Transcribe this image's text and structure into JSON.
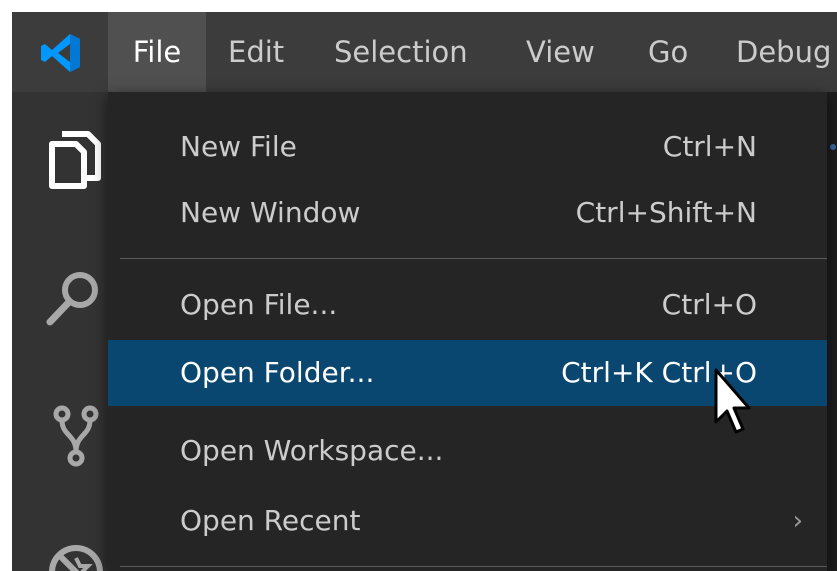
{
  "app": {
    "logo_icon": "vscode-logo-icon",
    "accent_color": "#0098ff"
  },
  "menubar": {
    "items": [
      {
        "label": "File",
        "active": true
      },
      {
        "label": "Edit"
      },
      {
        "label": "Selection"
      },
      {
        "label": "View"
      },
      {
        "label": "Go"
      },
      {
        "label": "Debug"
      }
    ]
  },
  "activitybar": {
    "icons": [
      "files-icon",
      "search-icon",
      "source-control-icon",
      "extensions-icon"
    ]
  },
  "file_menu": {
    "items": [
      {
        "label": "New File",
        "shortcut": "Ctrl+N"
      },
      {
        "label": "New Window",
        "shortcut": "Ctrl+Shift+N"
      },
      {
        "label": "Open File...",
        "shortcut": "Ctrl+O"
      },
      {
        "label": "Open Folder...",
        "shortcut": "Ctrl+K Ctrl+O",
        "selected": true
      },
      {
        "label": "Open Workspace..."
      },
      {
        "label": "Open Recent",
        "submenu_icon": "chevron-right-icon"
      }
    ],
    "submenu_glyph": "›",
    "selection_color": "#094771"
  }
}
